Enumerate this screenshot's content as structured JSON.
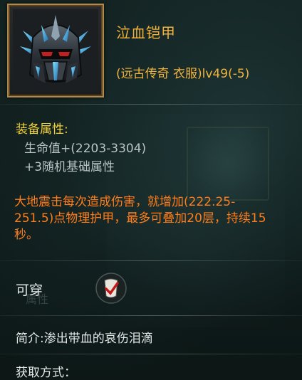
{
  "item": {
    "name": "泣血铠甲",
    "subtitle": "(远古传奇 衣服)lv49(-5)",
    "icon": "helmet-armor-icon"
  },
  "attributes": {
    "title": "装备属性:",
    "lines": [
      "生命值+(2203-3304)",
      "+3随机基础属性"
    ]
  },
  "effect": {
    "text": "大地震击每次造成伤害，就增加(222.25-251.5)点物理护甲，最多可叠加20层，持续15秒。"
  },
  "wear": {
    "label": "可穿",
    "icon": "equip-check-icon",
    "faded_label": "属性"
  },
  "description": {
    "text": "简介:渗出带血的哀伤泪滴"
  },
  "source": {
    "label": "获取方式："
  },
  "colors": {
    "name": "#f2b33d",
    "attr_title": "#f2d03a",
    "effect": "#ff7d1a",
    "stat": "#b9c4c4"
  }
}
